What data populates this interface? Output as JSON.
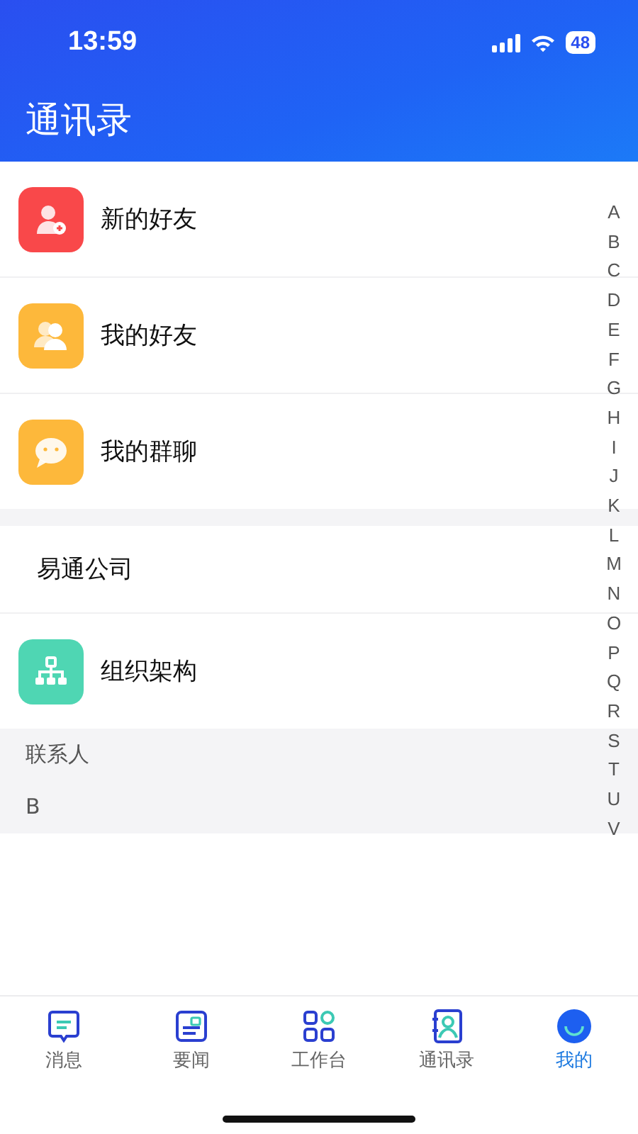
{
  "status_bar": {
    "time": "13:59",
    "battery": "48"
  },
  "title": "通讯录",
  "groups": [
    [
      {
        "kind": "icon",
        "label": "新的好友",
        "color": "#f9484a"
      },
      {
        "kind": "icon",
        "label": "我的好友",
        "color": "#fdb83b"
      },
      {
        "kind": "icon",
        "label": "我的群聊",
        "color": "#fdb83b"
      }
    ],
    [
      {
        "kind": "text",
        "label": "易通公司"
      },
      {
        "kind": "icon",
        "label": "组织架构",
        "color": "#4fd6b3"
      }
    ]
  ],
  "contacts_header": "联系人",
  "sections": [
    "B"
  ],
  "index_letters": [
    "A",
    "B",
    "C",
    "D",
    "E",
    "F",
    "G",
    "H",
    "I",
    "J",
    "K",
    "L",
    "M",
    "N",
    "O",
    "P",
    "Q",
    "R",
    "S",
    "T",
    "U",
    "V"
  ],
  "tab_bar": [
    {
      "label": "消息",
      "selected": false
    },
    {
      "label": "要闻",
      "selected": false
    },
    {
      "label": "工作台",
      "selected": false
    },
    {
      "label": "通讯录",
      "selected": false
    },
    {
      "label": "我的",
      "selected": true
    }
  ]
}
